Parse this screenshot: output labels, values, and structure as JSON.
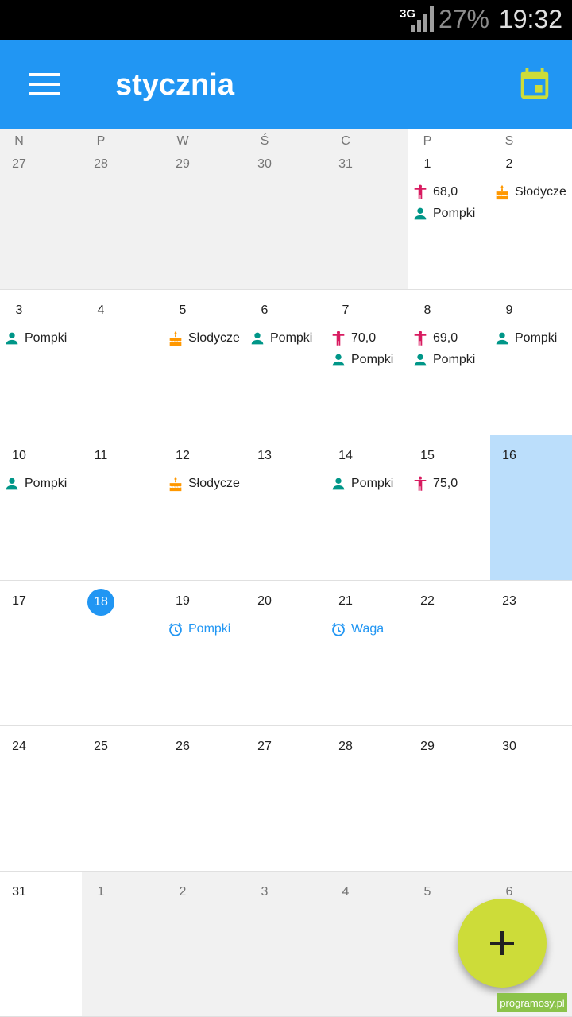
{
  "status_bar": {
    "network": "3G",
    "battery": "27%",
    "time": "19:32"
  },
  "app_bar": {
    "title": "stycznia",
    "menu_icon": "hamburger-menu-icon",
    "today_icon": "calendar-today-icon"
  },
  "colors": {
    "primary": "#2196f3",
    "accent": "#cddc39",
    "weight": "#d81b60",
    "exercise": "#009688",
    "sweets": "#ff9800",
    "highlight": "#bbdefb",
    "out_of_month": "#f1f1f1"
  },
  "weekdays": [
    "N",
    "P",
    "W",
    "Ś",
    "C",
    "P",
    "S"
  ],
  "weeks": [
    {
      "days": [
        {
          "num": "27",
          "out": true,
          "events": []
        },
        {
          "num": "28",
          "out": true,
          "events": []
        },
        {
          "num": "29",
          "out": true,
          "events": []
        },
        {
          "num": "30",
          "out": true,
          "events": []
        },
        {
          "num": "31",
          "out": true,
          "events": []
        },
        {
          "num": "1",
          "events": [
            {
              "type": "weight",
              "label": "68,0"
            },
            {
              "type": "exercise",
              "label": "Pompki"
            }
          ]
        },
        {
          "num": "2",
          "events": [
            {
              "type": "sweets",
              "label": "Słodycze"
            }
          ]
        }
      ]
    },
    {
      "days": [
        {
          "num": "3",
          "events": [
            {
              "type": "exercise",
              "label": "Pompki"
            }
          ]
        },
        {
          "num": "4",
          "events": []
        },
        {
          "num": "5",
          "events": [
            {
              "type": "sweets",
              "label": "Słodycze"
            }
          ]
        },
        {
          "num": "6",
          "events": [
            {
              "type": "exercise",
              "label": "Pompki"
            }
          ]
        },
        {
          "num": "7",
          "events": [
            {
              "type": "weight",
              "label": "70,0"
            },
            {
              "type": "exercise",
              "label": "Pompki"
            }
          ]
        },
        {
          "num": "8",
          "events": [
            {
              "type": "weight",
              "label": "69,0"
            },
            {
              "type": "exercise",
              "label": "Pompki"
            }
          ]
        },
        {
          "num": "9",
          "events": [
            {
              "type": "exercise",
              "label": "Pompki"
            }
          ]
        }
      ]
    },
    {
      "days": [
        {
          "num": "10",
          "events": [
            {
              "type": "exercise",
              "label": "Pompki"
            }
          ]
        },
        {
          "num": "11",
          "events": []
        },
        {
          "num": "12",
          "events": [
            {
              "type": "sweets",
              "label": "Słodycze"
            }
          ]
        },
        {
          "num": "13",
          "events": []
        },
        {
          "num": "14",
          "events": [
            {
              "type": "exercise",
              "label": "Pompki"
            }
          ]
        },
        {
          "num": "15",
          "events": [
            {
              "type": "weight",
              "label": "75,0"
            }
          ]
        },
        {
          "num": "16",
          "highlight": true,
          "events": []
        }
      ]
    },
    {
      "days": [
        {
          "num": "17",
          "events": []
        },
        {
          "num": "18",
          "today": true,
          "events": []
        },
        {
          "num": "19",
          "events": [
            {
              "type": "reminder",
              "label": "Pompki"
            }
          ]
        },
        {
          "num": "20",
          "events": []
        },
        {
          "num": "21",
          "events": [
            {
              "type": "reminder",
              "label": "Waga"
            }
          ]
        },
        {
          "num": "22",
          "events": []
        },
        {
          "num": "23",
          "events": []
        }
      ]
    },
    {
      "days": [
        {
          "num": "24",
          "events": []
        },
        {
          "num": "25",
          "events": []
        },
        {
          "num": "26",
          "events": []
        },
        {
          "num": "27",
          "events": []
        },
        {
          "num": "28",
          "events": []
        },
        {
          "num": "29",
          "events": []
        },
        {
          "num": "30",
          "events": []
        }
      ]
    },
    {
      "days": [
        {
          "num": "31",
          "events": []
        },
        {
          "num": "1",
          "out": true,
          "events": []
        },
        {
          "num": "2",
          "out": true,
          "events": []
        },
        {
          "num": "3",
          "out": true,
          "events": []
        },
        {
          "num": "4",
          "out": true,
          "events": []
        },
        {
          "num": "5",
          "out": true,
          "events": []
        },
        {
          "num": "6",
          "out": true,
          "events": []
        }
      ]
    }
  ],
  "fab": {
    "icon": "plus-icon"
  },
  "watermark": "programosy.pl"
}
